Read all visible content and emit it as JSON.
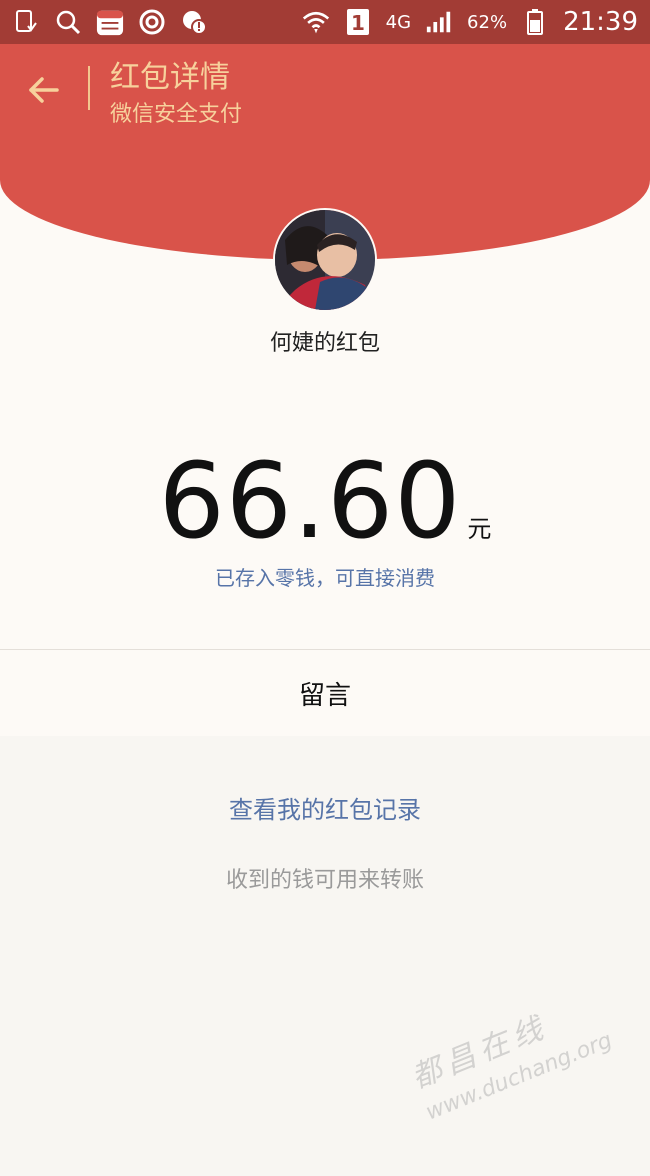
{
  "status_bar": {
    "battery_percent": "62%",
    "network": "4G",
    "sim_slot": "1",
    "time": "21:39"
  },
  "header": {
    "title": "红包详情",
    "subtitle": "微信安全支付"
  },
  "red_packet": {
    "sender": "何婕的红包",
    "amount": "66.60",
    "unit": "元",
    "status_note": "已存入零钱，可直接消费"
  },
  "message_label": "留言",
  "records_link": "查看我的红包记录",
  "hint": "收到的钱可用来转账",
  "watermark": {
    "title": "都昌在线",
    "url": "www.duchang.org"
  }
}
